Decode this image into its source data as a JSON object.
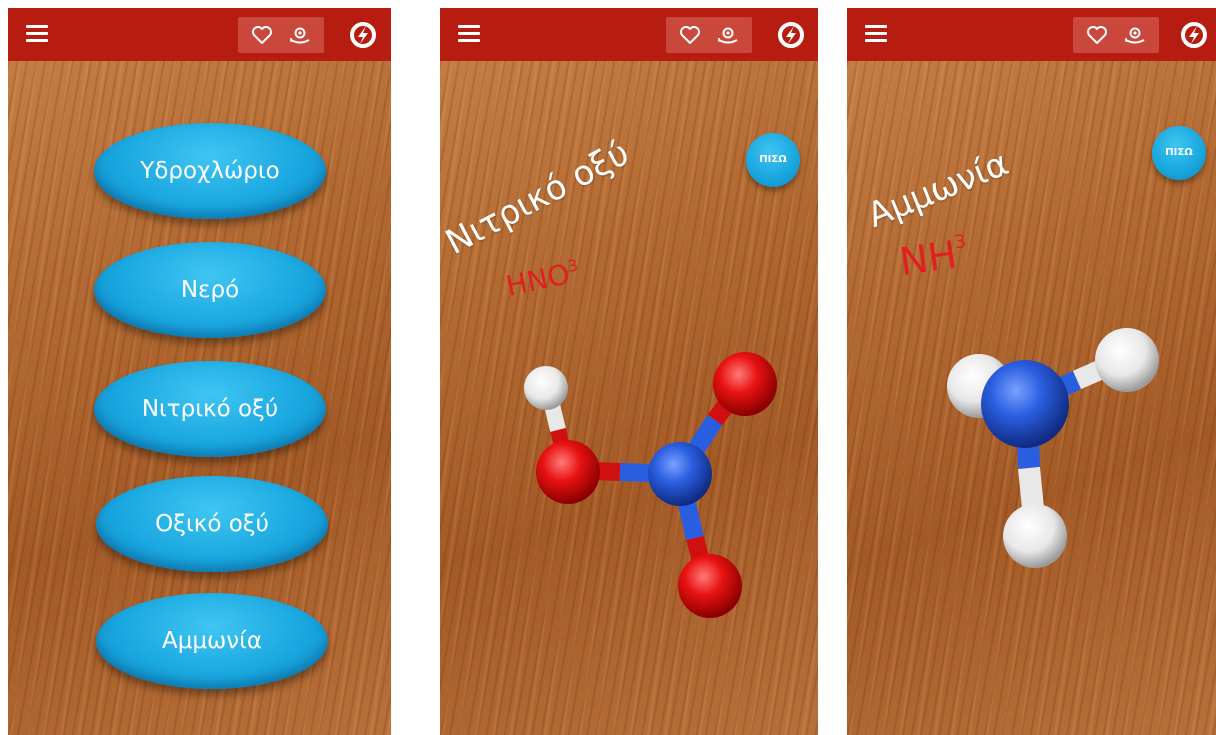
{
  "screens": [
    {
      "id": "menu",
      "buttons": [
        "Υδροχλώριο",
        "Νερό",
        "Νιτρικό οξύ",
        "Οξικό οξύ",
        "Αμμωνία"
      ]
    },
    {
      "id": "nitric",
      "name": "Νιτρικό οξύ",
      "formula_main": "HNO",
      "formula_sub": "3",
      "back_label": "ΠΙΣΩ"
    },
    {
      "id": "ammonia",
      "name": "Αμμωνία",
      "formula_main": "NH",
      "formula_sub": "3",
      "back_label": "ΠΙΣΩ"
    }
  ],
  "toolbar_icons": [
    "menu-icon",
    "heart-icon",
    "camera-switch-icon",
    "brand-logo-icon"
  ],
  "colors": {
    "topbar": "#b71c10",
    "button_blue": "#1aa8e0",
    "formula_red": "#e02020",
    "oxygen": "#e01010",
    "nitrogen": "#2656d8",
    "hydrogen": "#f2f2f2"
  }
}
